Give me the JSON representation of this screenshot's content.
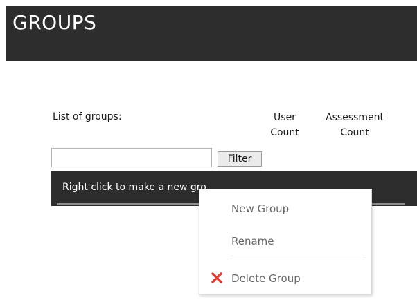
{
  "header": {
    "title": "GROUPS"
  },
  "groups_panel": {
    "list_label": "List of groups:",
    "columns": {
      "user_count": "User Count",
      "assessment_count": "Assessment Count"
    },
    "filter": {
      "value": "",
      "placeholder": "",
      "button_label": "Filter"
    },
    "list_hint": "Right click to make a new gro"
  },
  "context_menu": {
    "items": [
      {
        "label": "New Group",
        "icon": ""
      },
      {
        "label": "Rename",
        "icon": ""
      },
      {
        "label": "Delete Group",
        "icon": "red-x-icon"
      }
    ]
  },
  "colors": {
    "header_bg": "#2d2d2d",
    "list_bg": "#2d2d2d",
    "menu_text": "#666666",
    "delete_icon": "#e03c31"
  }
}
